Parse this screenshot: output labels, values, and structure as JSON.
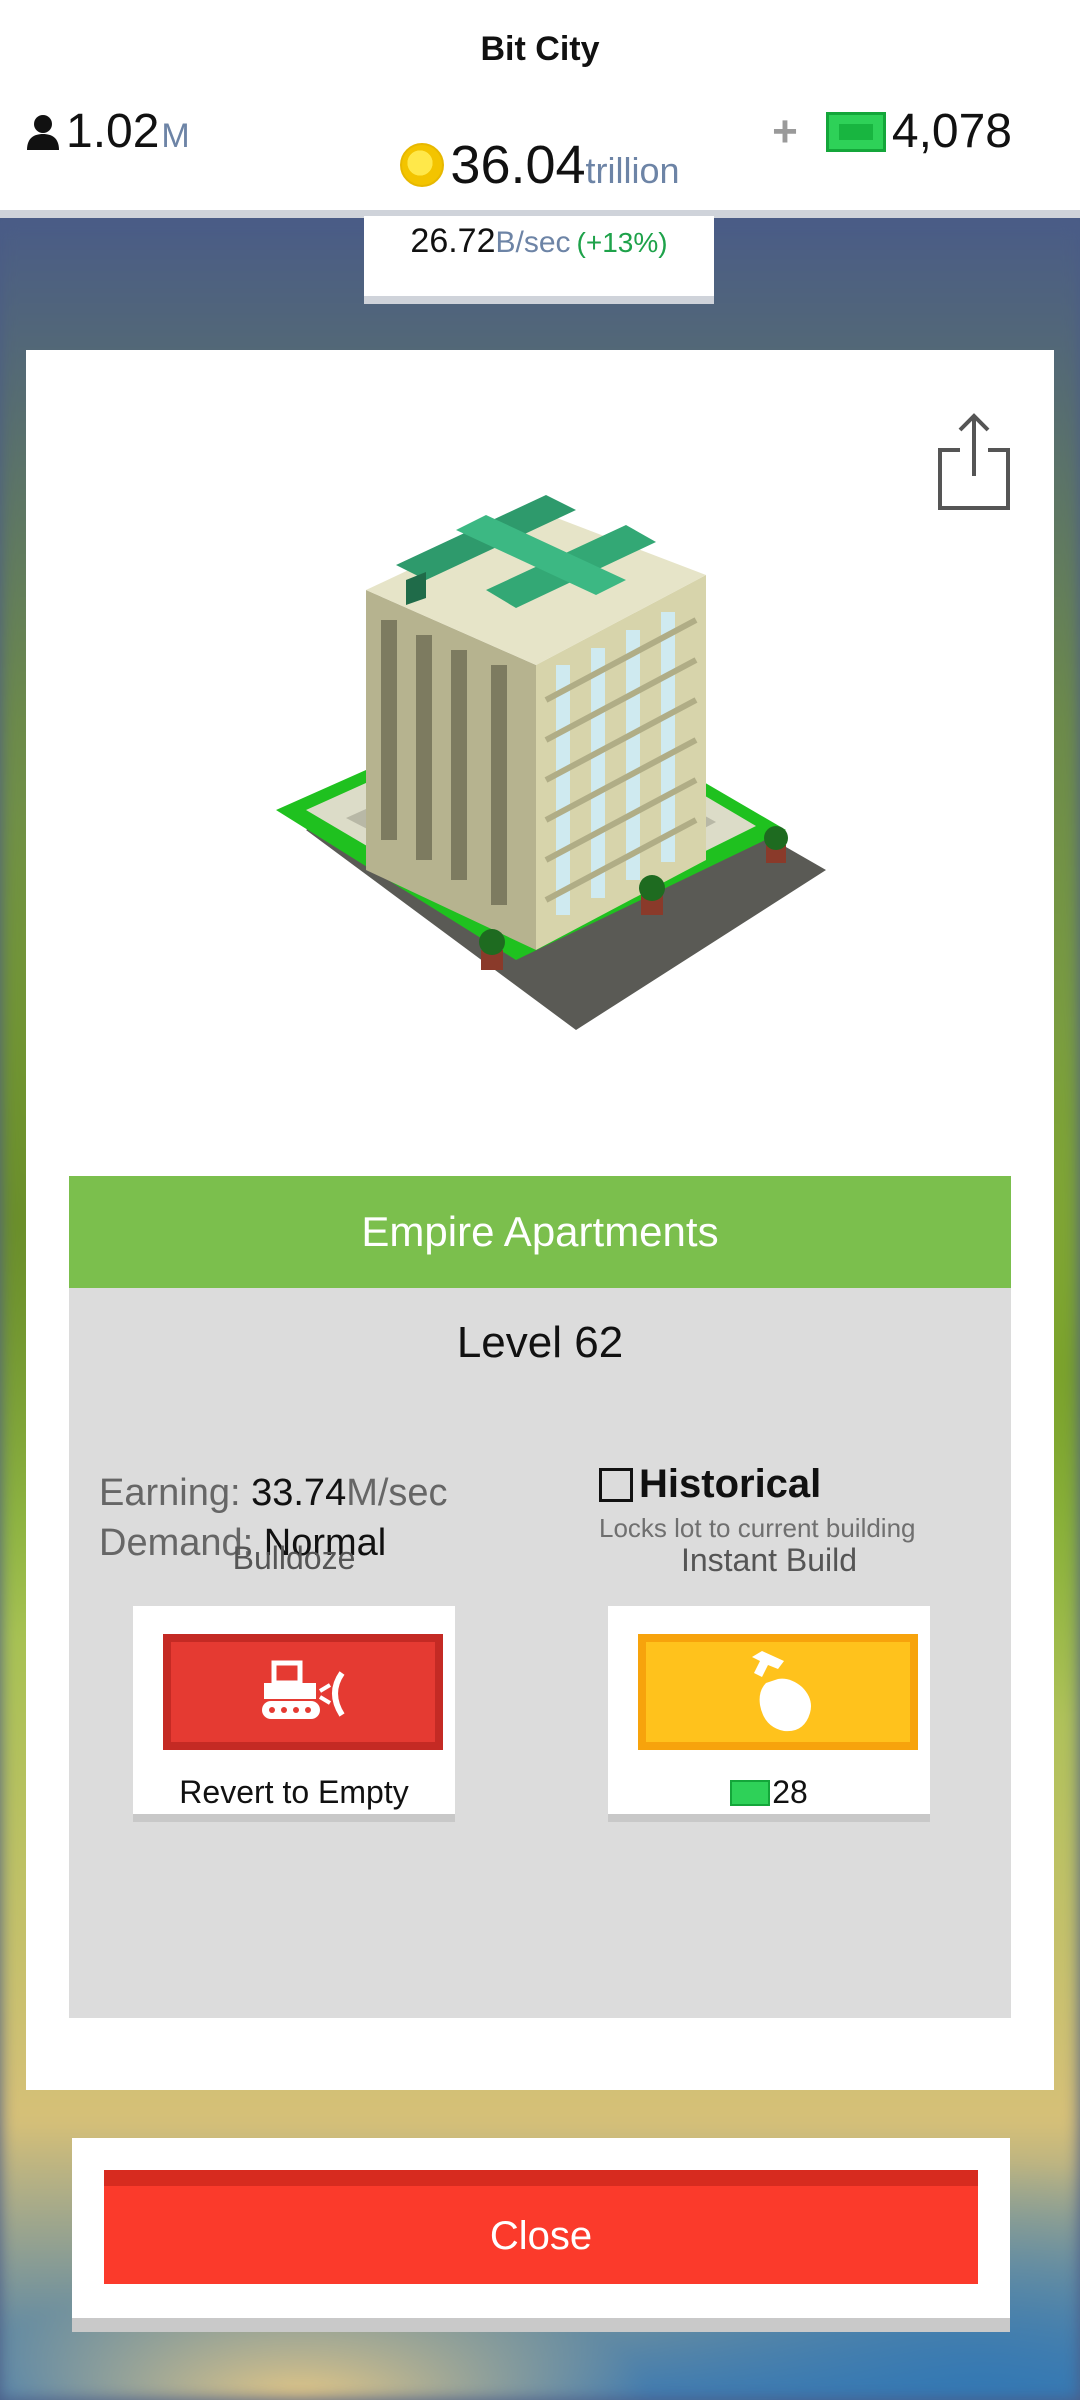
{
  "header": {
    "app_title": "Bit City",
    "population_value": "1.02",
    "population_unit": "M",
    "money_value": "36.04",
    "money_unit": "trillion",
    "cash_plus": "+",
    "cash_value": "4,078",
    "rate_value": "26.72",
    "rate_unit": "B/sec",
    "rate_bonus": "(+13%)"
  },
  "building": {
    "name": "Empire Apartments",
    "level": "Level 62",
    "earning_label": "Earning:",
    "earning_value": "33.74",
    "earning_unit": "M/sec",
    "demand_label": "Demand:",
    "demand_value": "Normal"
  },
  "historical": {
    "label": "Historical",
    "description": "Locks lot to current building"
  },
  "actions": {
    "bulldoze_label": "Bulldoze",
    "bulldoze_caption": "Revert to Empty",
    "instant_label": "Instant Build",
    "instant_cost": "28"
  },
  "close_label": "Close",
  "icons": {
    "population": "person-icon",
    "money": "coin-icon",
    "cash": "bill-icon",
    "share": "share-icon",
    "bulldoze": "bulldozer-icon",
    "instant": "hammer-hand-icon"
  },
  "colors": {
    "title_bar": "#7bbf4d",
    "bulldoze": "#e53a32",
    "instant": "#ffc21c",
    "close": "#fb3a2b",
    "cash": "#2ed158"
  }
}
